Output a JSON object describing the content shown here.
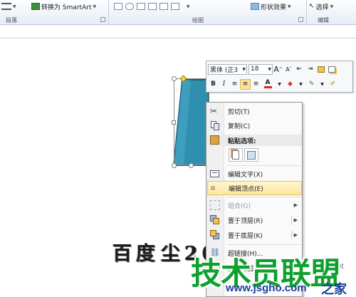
{
  "ribbon": {
    "convert_smartart": "转换为 SmartArt",
    "shape_effects": "形状效果",
    "select": "选择",
    "groups": {
      "paragraph": "段落",
      "drawing": "绘图",
      "editing": "编辑"
    }
  },
  "slide": {
    "text_line1": "百度",
    "text_line2": "尘2011",
    "shape_color": "#2f8fae"
  },
  "mini_toolbar": {
    "font_name": "黑体 (正3",
    "font_size": "18",
    "grow_font": "A",
    "shrink_font": "A",
    "bold": "B",
    "italic": "I",
    "font_color_letter": "A"
  },
  "context_menu": {
    "cut": "剪切(T)",
    "copy": "复制(C)",
    "paste_options": "粘贴选项:",
    "edit_text": "编辑文字(X)",
    "edit_points": "编辑顶点(E)",
    "group": "组合(G)",
    "bring_to_front": "置于顶层(R)",
    "send_to_back": "置于底层(K)",
    "hyperlink": "超链接(H)...",
    "save_as_picture": "另存为图片(S)..."
  },
  "watermark": {
    "site_name": "技术员联盟",
    "url": "www.jsgho.com",
    "suffix": "之家",
    "domain_fragment": "51.net"
  },
  "colors": {
    "accent_green": "#10a030",
    "url_blue": "#1b3f9a",
    "hover_yellow": "#fde7a0"
  }
}
